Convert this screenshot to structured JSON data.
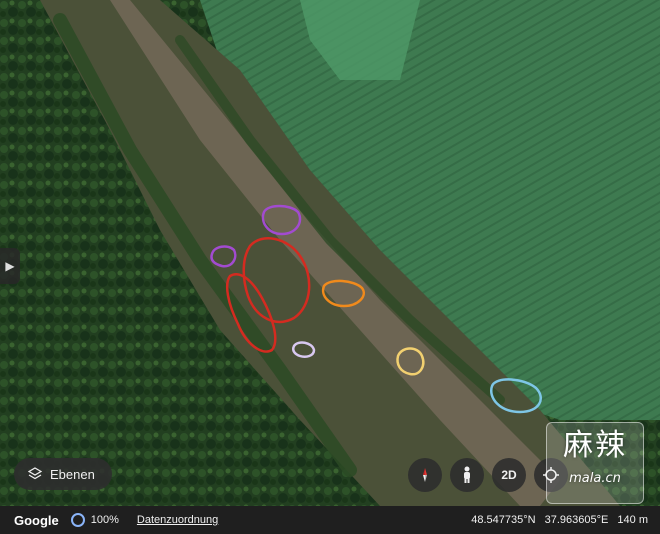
{
  "map": {
    "view": "satellite",
    "colors": {
      "forest": "#1e3b1c",
      "field": "#3f7a52",
      "road": "#6c6352",
      "strip": "#4a4a38"
    },
    "annotations": [
      {
        "shape": "outline",
        "color": "#a24bd0"
      },
      {
        "shape": "outline",
        "color": "#a24bd0"
      },
      {
        "shape": "outline",
        "color": "#d42b20"
      },
      {
        "shape": "outline",
        "color": "#d42b20"
      },
      {
        "shape": "outline",
        "color": "#f08a1c"
      },
      {
        "shape": "outline",
        "color": "#d8c8f0"
      },
      {
        "shape": "outline",
        "color": "#f2d070"
      },
      {
        "shape": "outline",
        "color": "#7ec6e6"
      }
    ]
  },
  "controls": {
    "side_panel_icon": "chevron-right-icon",
    "layers_label": "Ebenen",
    "layers_icon": "layers-icon",
    "compass_icon": "compass-icon",
    "pegman_icon": "pegman-icon",
    "view_mode_label": "2D",
    "locate_icon": "crosshair-icon"
  },
  "watermark": {
    "main": "麻辣",
    "sub": "mala.cn"
  },
  "status_bar": {
    "logo": "Google",
    "progress": "100%",
    "attribution": "Datenzuordnung",
    "latitude": "48.547735°N",
    "longitude": "37.963605°E",
    "altitude": "140 m"
  }
}
